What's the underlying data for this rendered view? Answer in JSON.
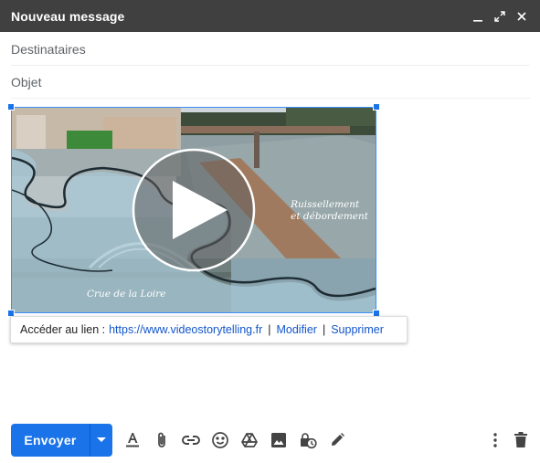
{
  "header": {
    "title": "Nouveau message"
  },
  "fields": {
    "recipients_placeholder": "Destinataires",
    "subject_placeholder": "Objet"
  },
  "video": {
    "caption_right_line1": "Ruissellement",
    "caption_right_line2": "et débordement",
    "caption_left": "Crue de la Loire"
  },
  "link_tooltip": {
    "label": "Accéder au lien :",
    "url": "https://www.videostorytelling.fr",
    "separator": "|",
    "edit": "Modifier",
    "remove": "Supprimer"
  },
  "toolbar": {
    "send_label": "Envoyer"
  },
  "colors": {
    "header_bg": "#404040",
    "accent": "#1a73e8",
    "link": "#1155cc"
  }
}
